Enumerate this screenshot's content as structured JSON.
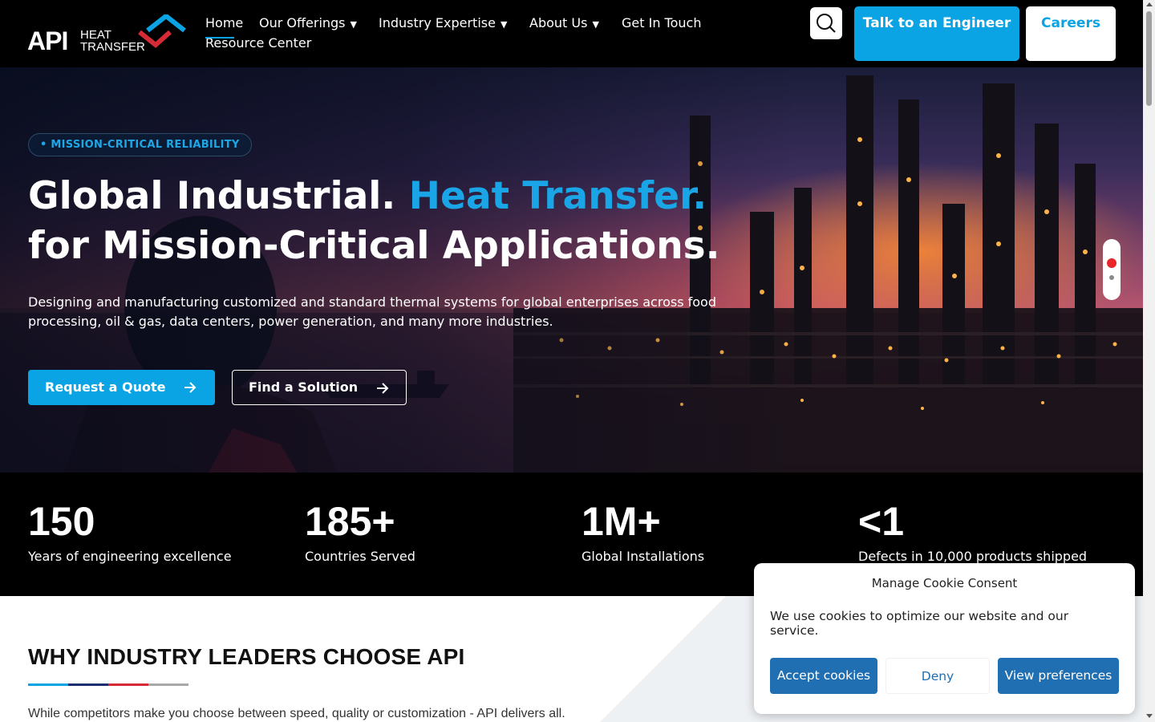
{
  "header": {
    "logo": {
      "primary": "API",
      "line1": "HEAT",
      "line2": "TRANSFER"
    },
    "nav": {
      "home": "Home",
      "offerings": "Our Offerings",
      "industry": "Industry Expertise",
      "about": "About Us",
      "contact": "Get In Touch",
      "resources": "Resource Center"
    },
    "talk_button": "Talk to an Engineer",
    "careers_button": "Careers",
    "search_icon": "search-icon"
  },
  "hero": {
    "badge": "• MISSION-CRITICAL RELIABILITY",
    "title_part1": "Global Industrial. ",
    "title_accent": "Heat Transfer.",
    "title_part2": " for Mission-Critical Applications.",
    "subtitle": "Designing and manufacturing customized and standard thermal systems for global enterprises across food processing, oil & gas, data centers, power generation, and many more industries.",
    "quote_button": "Request a Quote",
    "solution_button": "Find a Solution",
    "slides_total": 2,
    "active_slide": 1
  },
  "stats": [
    {
      "value": "150",
      "label": "Years of engineering excellence"
    },
    {
      "value": "185+",
      "label": "Countries Served"
    },
    {
      "value": "1M+",
      "label": "Global Installations"
    },
    {
      "value": "<1",
      "label": "Defects in 10,000 products shipped"
    }
  ],
  "why": {
    "title": "WHY INDUSTRY LEADERS CHOOSE API",
    "text": "While competitors make you choose between speed, quality or customization - API delivers all.",
    "bar_colors": [
      "#0aa4e5",
      "#1b2f6e",
      "#d42b36",
      "#a8a8a8"
    ]
  },
  "cookie": {
    "title": "Manage Cookie Consent",
    "text": "We use cookies to optimize our website and our service.",
    "accept": "Accept cookies",
    "deny": "Deny",
    "preferences": "View preferences"
  },
  "colors": {
    "accent": "#0aa4e5",
    "header_bg": "#000000",
    "cookie_button": "#1f6fb2"
  }
}
